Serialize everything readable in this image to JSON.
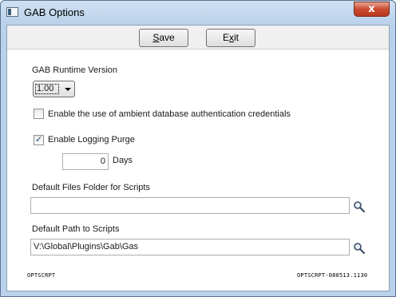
{
  "window": {
    "title": "GAB Options",
    "close_glyph": "x",
    "icon": "app-window-icon"
  },
  "toolbar": {
    "save_label_pre": "",
    "save_label_accel": "S",
    "save_label_post": "ave",
    "exit_label_pre": "E",
    "exit_label_accel": "x",
    "exit_label_post": "it"
  },
  "runtime": {
    "label": "GAB Runtime Version",
    "selected": "1.00"
  },
  "ambient_auth": {
    "label": "Enable the use of ambient database authentication credentials",
    "checked": false
  },
  "logging_purge": {
    "label": "Enable Logging Purge",
    "checked": true,
    "days_value": "0",
    "days_label": "Days"
  },
  "files_folder": {
    "label": "Default Files Folder for Scripts",
    "value": "",
    "browse_icon": "search-icon"
  },
  "scripts_path": {
    "label": "Default Path to Scripts",
    "value": "V:\\Global\\Plugins\\Gab\\Gas",
    "browse_icon": "search-icon"
  },
  "footer": {
    "left": "OPTSCRPT",
    "right": "OPTSCRPT-080513.1130"
  }
}
